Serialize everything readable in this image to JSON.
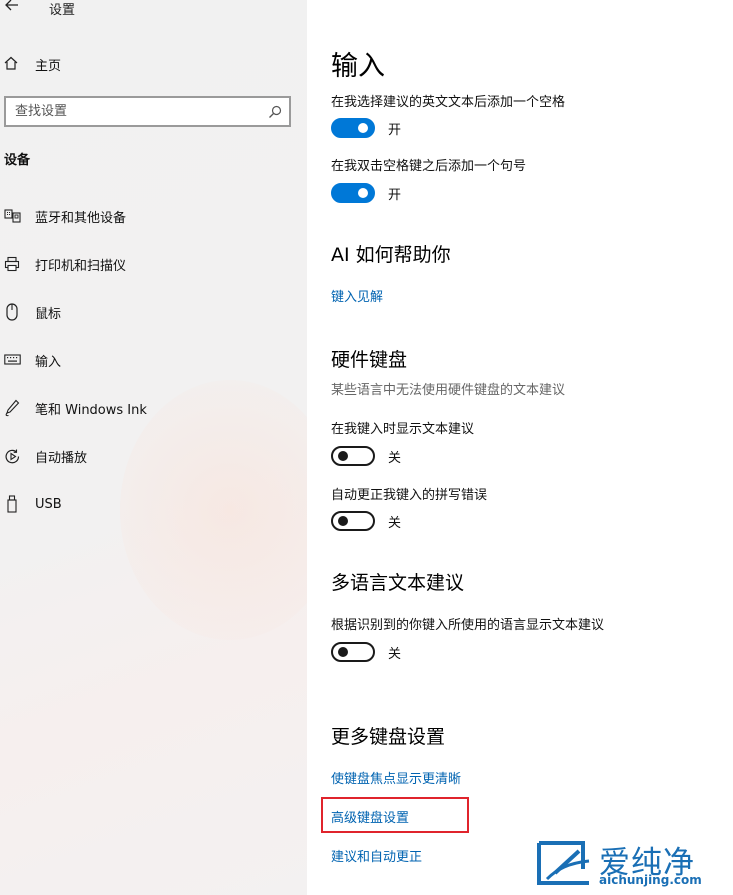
{
  "window": {
    "title": "设置"
  },
  "sidebar": {
    "home_label": "主页",
    "search_placeholder": "查找设置",
    "section_label": "设备",
    "items": [
      {
        "label": "蓝牙和其他设备",
        "icon": "bluetooth-devices-icon"
      },
      {
        "label": "打印机和扫描仪",
        "icon": "printer-icon"
      },
      {
        "label": "鼠标",
        "icon": "mouse-icon"
      },
      {
        "label": "输入",
        "icon": "keyboard-icon"
      },
      {
        "label": "笔和 Windows Ink",
        "icon": "pen-icon"
      },
      {
        "label": "自动播放",
        "icon": "autoplay-icon"
      },
      {
        "label": "USB",
        "icon": "usb-icon"
      }
    ]
  },
  "main": {
    "title": "输入",
    "settings": [
      {
        "label": "在我选择建议的英文文本后添加一个空格",
        "state": "开",
        "on": true
      },
      {
        "label": "在我双击空格键之后添加一个句号",
        "state": "开",
        "on": true
      }
    ],
    "ai_section": {
      "heading": "AI 如何帮助你",
      "link": "键入见解"
    },
    "hardware_keyboard": {
      "heading": "硬件键盘",
      "description": "某些语言中无法使用硬件键盘的文本建议",
      "settings": [
        {
          "label": "在我键入时显示文本建议",
          "state": "关",
          "on": false
        },
        {
          "label": "自动更正我键入的拼写错误",
          "state": "关",
          "on": false
        }
      ]
    },
    "multilingual": {
      "heading": "多语言文本建议",
      "settings": [
        {
          "label": "根据识别到的你键入所使用的语言显示文本建议",
          "state": "关",
          "on": false
        }
      ]
    },
    "more_keyboard": {
      "heading": "更多键盘设置",
      "links": [
        "使键盘焦点显示更清晰",
        "高级键盘设置",
        "建议和自动更正"
      ]
    }
  },
  "watermark": {
    "name": "爱纯净",
    "url": "aichunjing.com"
  },
  "colors": {
    "accent": "#0078d7",
    "link": "#0063b1",
    "highlight": "#e0242c"
  }
}
